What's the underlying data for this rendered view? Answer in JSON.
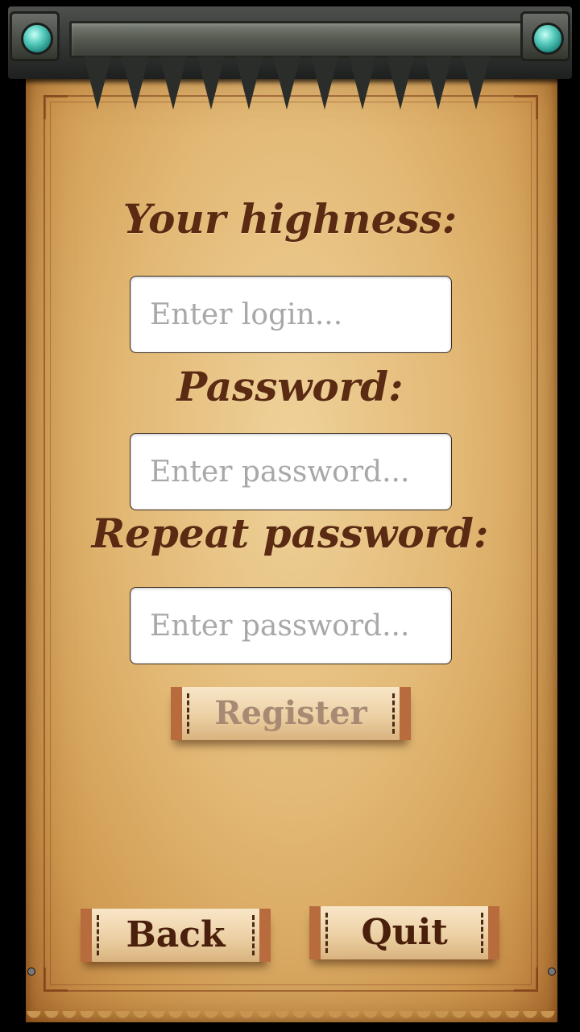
{
  "form": {
    "login_label": "Your highness:",
    "login_placeholder": "Enter login...",
    "password_label": "Password:",
    "password_placeholder": "Enter password...",
    "repeat_label": "Repeat password:",
    "repeat_placeholder": "Enter password..."
  },
  "buttons": {
    "register": "Register",
    "back": "Back",
    "quit": "Quit"
  },
  "colors": {
    "label_text": "#5a2a12",
    "register_text": "#a88a74",
    "gem": "#5fd0c2"
  },
  "icons": [
    "gem-left-icon",
    "gem-right-icon"
  ]
}
